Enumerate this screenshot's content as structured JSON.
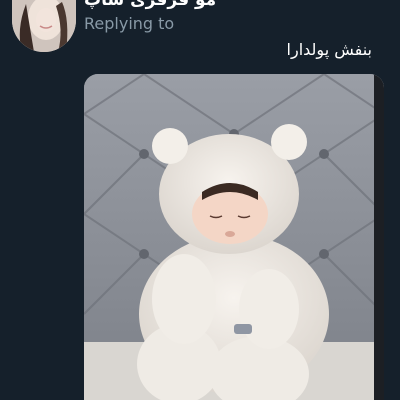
{
  "author": {
    "name": "مو فرفری شاپ"
  },
  "reply": {
    "label": "Replying to"
  },
  "tweet": {
    "text": "بنفش پولدارا"
  },
  "icons": {
    "avatar": "profile-photo",
    "media": "photo-baby-in-white-teddy-suit"
  },
  "colors": {
    "background": "#15202b",
    "text": "#ffffff",
    "muted": "#8899a6"
  }
}
